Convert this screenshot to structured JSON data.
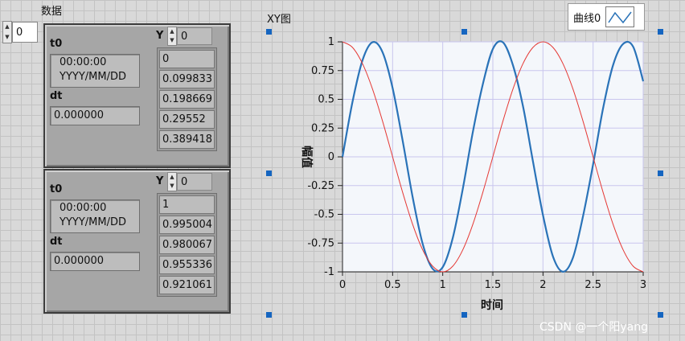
{
  "array_label": "数据",
  "array_index": "0",
  "clusters": [
    {
      "t0_label": "t0",
      "t0_time": "00:00:00",
      "t0_date": "YYYY/MM/DD",
      "dt_label": "dt",
      "dt_value": "0.000000",
      "y_label": "Y",
      "y_index": "0",
      "y_values": [
        "0",
        "0.099833",
        "0.198669",
        "0.29552",
        "0.389418"
      ]
    },
    {
      "t0_label": "t0",
      "t0_time": "00:00:00",
      "t0_date": "YYYY/MM/DD",
      "dt_label": "dt",
      "dt_value": "0.000000",
      "y_label": "Y",
      "y_index": "0",
      "y_values": [
        "1",
        "0.995004",
        "0.980067",
        "0.955336",
        "0.921061"
      ]
    }
  ],
  "graph": {
    "title": "XY图",
    "legend_label": "曲线0",
    "plot_bg": "#f4f7fb",
    "grid_color": "#c9c6ee",
    "watermark": "CSDN @一个阳yang"
  },
  "chart_data": {
    "type": "line",
    "title": "XY图",
    "xlabel": "时间",
    "ylabel": "幅值",
    "xlim": [
      0,
      3
    ],
    "ylim": [
      -1,
      1
    ],
    "grid": true,
    "legend_position": "top-right",
    "x_ticks": [
      "0",
      "0.5",
      "1",
      "1.5",
      "2",
      "2.5",
      "3"
    ],
    "y_ticks": [
      "1",
      "0.75",
      "0.5",
      "0.25",
      "0",
      "-0.25",
      "-0.5",
      "-0.75",
      "-1"
    ],
    "series": [
      {
        "name": "曲线0",
        "color": "#2a73b8",
        "x": [
          0,
          0.1,
          0.2,
          0.3,
          0.4,
          0.5,
          0.6,
          0.7,
          0.8,
          0.9,
          1.0,
          1.1,
          1.2,
          1.3,
          1.4,
          1.5,
          1.6,
          1.7,
          1.8,
          1.9,
          2.0,
          2.1,
          2.2,
          2.3,
          2.4,
          2.5,
          2.6,
          2.7,
          2.8,
          2.9,
          3.0
        ],
        "y": [
          0,
          0.479,
          0.841,
          0.997,
          0.909,
          0.598,
          0.141,
          -0.351,
          -0.757,
          -0.974,
          -0.959,
          -0.706,
          -0.279,
          0.214,
          0.631,
          0.938,
          0.996,
          0.798,
          0.443,
          -0.039,
          -0.506,
          -0.867,
          -0.999,
          -0.875,
          -0.515,
          -0.066,
          0.423,
          0.799,
          0.982,
          0.957,
          0.657
        ]
      },
      {
        "color": "#e53935",
        "x": [
          0,
          0.1,
          0.2,
          0.3,
          0.4,
          0.5,
          0.6,
          0.7,
          0.8,
          0.9,
          1.0,
          1.1,
          1.2,
          1.3,
          1.4,
          1.5,
          1.6,
          1.7,
          1.8,
          1.9,
          2.0,
          2.1,
          2.2,
          2.3,
          2.4,
          2.5,
          2.6,
          2.7,
          2.8,
          2.9,
          3.0
        ],
        "y": [
          1,
          0.951,
          0.809,
          0.588,
          0.309,
          0,
          -0.309,
          -0.588,
          -0.809,
          -0.951,
          -1,
          -0.951,
          -0.809,
          -0.588,
          -0.309,
          0,
          0.309,
          0.588,
          0.809,
          0.951,
          1,
          0.951,
          0.809,
          0.588,
          0.309,
          0,
          -0.309,
          -0.588,
          -0.809,
          -0.951,
          -1
        ]
      }
    ]
  }
}
